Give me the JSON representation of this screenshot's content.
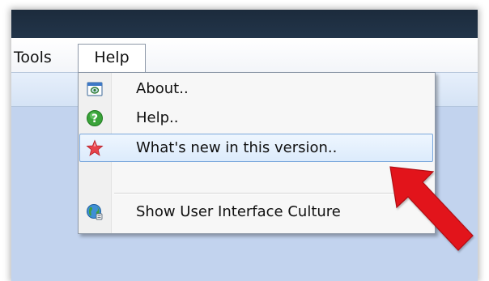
{
  "menubar": {
    "tools_label": "Tools",
    "help_label": "Help"
  },
  "help_menu": {
    "items": [
      {
        "label": "About..",
        "icon": "about-window-icon"
      },
      {
        "label": "Help..",
        "icon": "help-question-icon"
      },
      {
        "label": "What's new in this version..",
        "icon": "star-new-icon",
        "highlighted": true
      },
      {
        "label": "Show User Interface Culture",
        "icon": "globe-culture-icon"
      }
    ]
  },
  "colors": {
    "titlebar": "#1c2b3c",
    "highlight_border": "#7aa7dc",
    "pointer_arrow": "#e2141b",
    "background": "#c2d3ee"
  }
}
